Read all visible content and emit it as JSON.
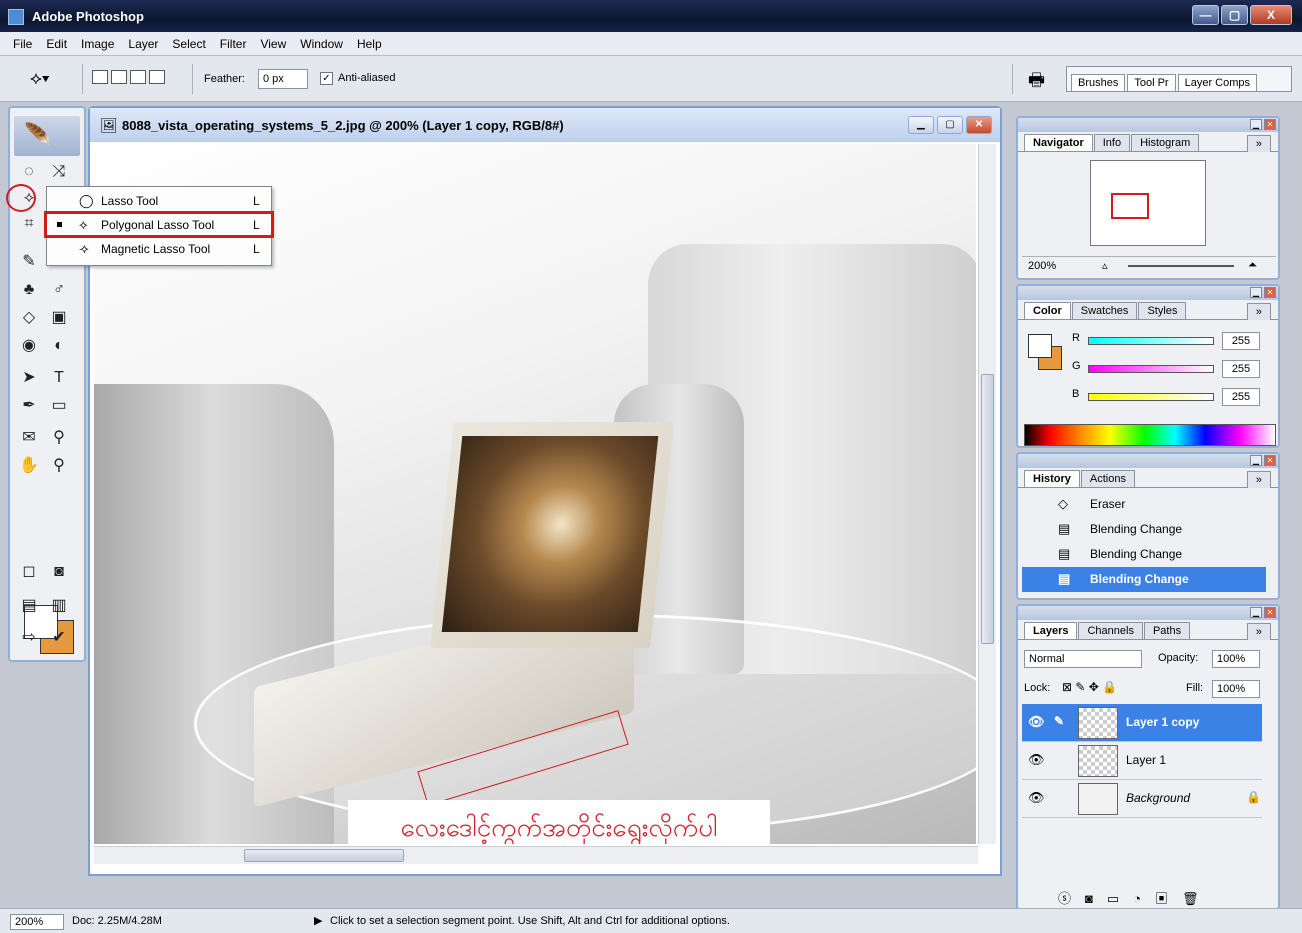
{
  "app": {
    "title": "Adobe Photoshop",
    "window_buttons": {
      "min": "—",
      "max": "▢",
      "close": "X"
    }
  },
  "menu": [
    "File",
    "Edit",
    "Image",
    "Layer",
    "Select",
    "Filter",
    "View",
    "Window",
    "Help"
  ],
  "options_bar": {
    "feather_label": "Feather:",
    "feather_value": "0 px",
    "antialiased_label": "Anti-aliased",
    "antialiased_checked": true,
    "palette_well_tabs": [
      "Brushes",
      "Tool Pr",
      "Layer Comps"
    ]
  },
  "tool_flyout": {
    "items": [
      {
        "label": "Lasso Tool",
        "key": "L",
        "selected": false
      },
      {
        "label": "Polygonal Lasso Tool",
        "key": "L",
        "selected": true
      },
      {
        "label": "Magnetic Lasso Tool",
        "key": "L",
        "selected": false
      }
    ]
  },
  "toolbox": {
    "foreground_color": "#ffffff",
    "background_color": "#e59a40"
  },
  "document": {
    "title": "8088_vista_operating_systems_5_2.jpg @ 200% (Layer 1 copy, RGB/8#)",
    "caption": "လေးဒေါင့်ကွက်အတိုင်းရွေးလိုက်ပါ",
    "caption_color": "#d0202a"
  },
  "navigator": {
    "tabs": [
      "Navigator",
      "Info",
      "Histogram"
    ],
    "zoom": "200%"
  },
  "color_panel": {
    "tabs": [
      "Color",
      "Swatches",
      "Styles"
    ],
    "channels": [
      {
        "name": "R",
        "value": "255"
      },
      {
        "name": "G",
        "value": "255"
      },
      {
        "name": "B",
        "value": "255"
      }
    ]
  },
  "history_panel": {
    "tabs": [
      "History",
      "Actions"
    ],
    "items": [
      {
        "label": "Eraser",
        "active": false
      },
      {
        "label": "Blending Change",
        "active": false
      },
      {
        "label": "Blending Change",
        "active": false
      },
      {
        "label": "Blending Change",
        "active": true
      }
    ]
  },
  "layers_panel": {
    "tabs": [
      "Layers",
      "Channels",
      "Paths"
    ],
    "blend_mode": "Normal",
    "opacity_label": "Opacity:",
    "opacity": "100%",
    "lock_label": "Lock:",
    "fill_label": "Fill:",
    "fill": "100%",
    "layers": [
      {
        "name": "Layer 1 copy",
        "active": true
      },
      {
        "name": "Layer 1",
        "active": false
      },
      {
        "name": "Background",
        "active": false,
        "locked": true
      }
    ]
  },
  "status_bar": {
    "zoom": "200%",
    "doc": "Doc: 2.25M/4.28M",
    "hint": "Click to set a selection segment point.  Use Shift, Alt and Ctrl for additional options."
  }
}
